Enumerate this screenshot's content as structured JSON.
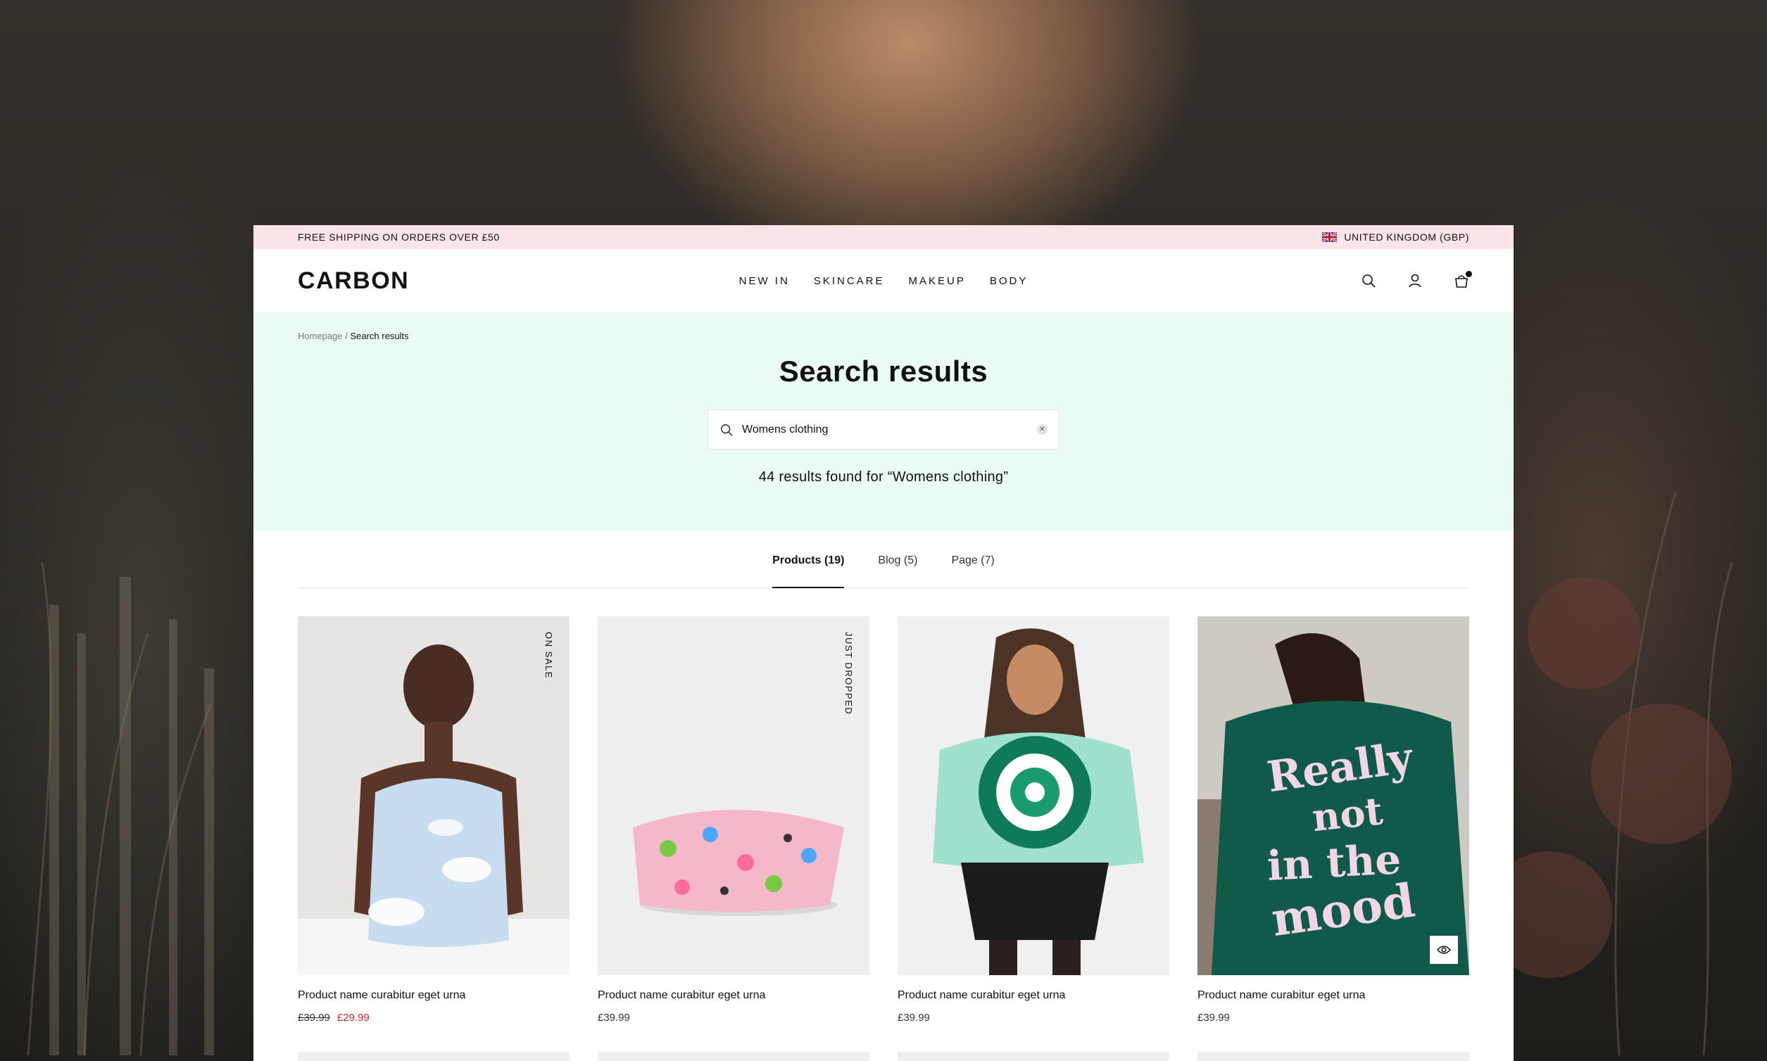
{
  "announcement": {
    "text": "FREE SHIPPING ON ORDERS OVER £50",
    "region": "UNITED KINGDOM (GBP)"
  },
  "header": {
    "logo": "CARBON",
    "nav": [
      "NEW IN",
      "SKINCARE",
      "MAKEUP",
      "BODY"
    ],
    "icons": [
      "search-icon",
      "account-icon",
      "cart-icon"
    ]
  },
  "breadcrumb": {
    "home": "Homepage",
    "separator": " / ",
    "current": "Search results"
  },
  "hero": {
    "title": "Search results",
    "search_value": "Womens clothing",
    "results_text": "44 results found for “Womens clothing”"
  },
  "tabs": [
    {
      "label": "Products (19)",
      "active": true
    },
    {
      "label": "Blog (5)",
      "active": false
    },
    {
      "label": "Page (7)",
      "active": false
    }
  ],
  "products": [
    {
      "name": "Product name curabitur eget urna",
      "old_price": "£39.99",
      "price": "£29.99",
      "badge": "ON SALE"
    },
    {
      "name": "Product name curabitur eget urna",
      "price": "£39.99",
      "badge": "JUST DROPPED"
    },
    {
      "name": "Product name curabitur eget urna",
      "price": "£39.99"
    },
    {
      "name": "Product name curabitur eget urna",
      "price": "£39.99",
      "artwork_text": "Really not in the mood"
    }
  ],
  "colors": {
    "announcement_bg": "#fde4e6",
    "hero_bg": "#eafcf3",
    "sale_price": "#d6222f"
  }
}
